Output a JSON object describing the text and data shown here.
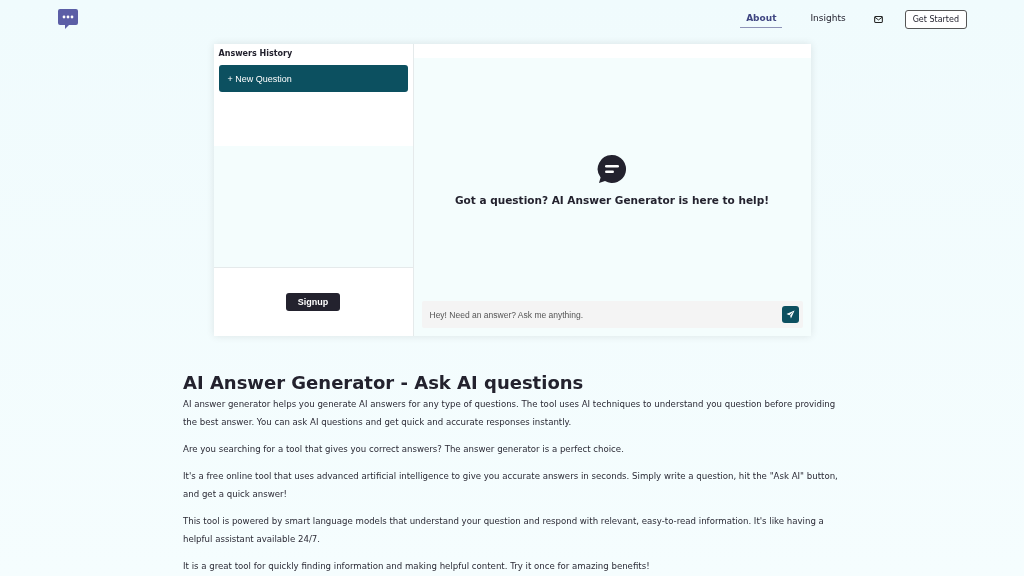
{
  "nav": {
    "items": [
      {
        "label": "About",
        "selected": true
      },
      {
        "label": "Insights",
        "selected": false
      }
    ],
    "cta": "Get Started"
  },
  "chat": {
    "sidebar_title": "Answers History",
    "new_button": "+ New Question",
    "signup": "Signup",
    "empty_message": "Got a question? AI Answer Generator is here to help!",
    "input": {
      "placeholder": "Hey! Need an answer? Ask me anything."
    }
  },
  "article": {
    "title": "AI Answer Generator - Ask AI questions",
    "paragraphs": [
      "AI answer generator helps you generate AI answers for any type of questions. The tool uses AI techniques to understand you question before providing the best answer. You can ask AI questions and get quick and accurate responses instantly.",
      "Are you searching for a tool that gives you correct answers? The answer generator is a perfect choice.",
      "It's a free online tool that uses advanced artificial intelligence to give you accurate answers in seconds. Simply write a question, hit the \"Ask AI\" button, and get a quick answer!",
      "This tool is powered by smart language models that understand your question and respond with relevant, easy-to-read information. It's like having a helpful assistant available 24/7.",
      "It is a great tool for quickly finding information and making helpful content. Try it once for amazing benefits!"
    ]
  }
}
